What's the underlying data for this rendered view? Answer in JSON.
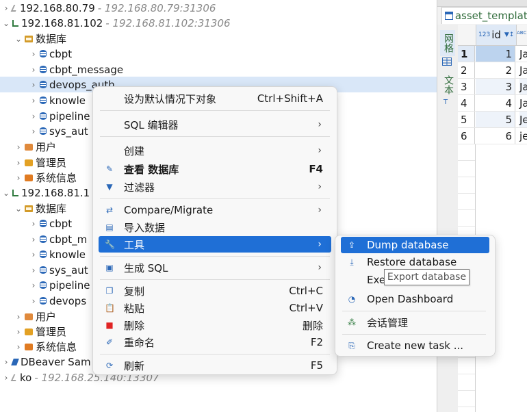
{
  "tree": {
    "conn1": {
      "name": "192.168.80.79",
      "addr": "- 192.168.80.79:31306"
    },
    "conn2": {
      "name": "192.168.81.102",
      "addr": "- 192.168.81.102:31306"
    },
    "conn2_databases": "数据库",
    "conn2_dbs": [
      "cbpt",
      "cbpt_message",
      "devops_auth",
      "knowle",
      "pipeline",
      "sys_aut"
    ],
    "conn2_users": "用户",
    "conn2_admins": "管理员",
    "conn2_sysinfo": "系统信息",
    "conn3": {
      "name": "192.168.81.1"
    },
    "conn3_databases": "数据库",
    "conn3_dbs": [
      "cbpt",
      "cbpt_m",
      "knowle",
      "sys_aut",
      "pipeline",
      "devops"
    ],
    "conn3_users": "用户",
    "conn3_admins": "管理员",
    "conn3_sysinfo": "系统信息",
    "sample": {
      "name": "DBeaver Sam"
    },
    "ko": {
      "name": "ko",
      "addr": "- 192.168.25.140:13307"
    }
  },
  "editor": {
    "tab_title": "asset_template",
    "side_tabs": [
      "网格",
      "文本"
    ],
    "column": "id",
    "rows": [
      {
        "num": "1",
        "id": "1",
        "name": "Ja"
      },
      {
        "num": "2",
        "id": "2",
        "name": "Ja"
      },
      {
        "num": "3",
        "id": "3",
        "name": "Ja"
      },
      {
        "num": "4",
        "id": "4",
        "name": "Ja"
      },
      {
        "num": "5",
        "id": "5",
        "name": "Je"
      },
      {
        "num": "6",
        "id": "6",
        "name": "je"
      }
    ]
  },
  "context_menu": {
    "items": [
      {
        "label": "设为默认情况下对象",
        "shortcut": "Ctrl+Shift+A"
      },
      {
        "label": "SQL 编辑器",
        "submenu": "›"
      },
      {
        "label": "创建",
        "submenu": "›"
      },
      {
        "label": "查看 数据库",
        "shortcut": "F4"
      },
      {
        "label": "过滤器",
        "submenu": "›"
      },
      {
        "label": "Compare/Migrate",
        "submenu": "›"
      },
      {
        "label": "导入数据"
      },
      {
        "label": "工具",
        "submenu": "›"
      },
      {
        "label": "生成 SQL",
        "submenu": "›"
      },
      {
        "label": "复制",
        "shortcut": "Ctrl+C"
      },
      {
        "label": "粘贴",
        "shortcut": "Ctrl+V"
      },
      {
        "label": "删除",
        "shortcut": "删除"
      },
      {
        "label": "重命名",
        "shortcut": "F2"
      },
      {
        "label": "刷新",
        "shortcut": "F5"
      }
    ]
  },
  "tools_submenu": {
    "items": [
      "Dump database",
      "Restore database",
      "Exe",
      "Open Dashboard",
      "会话管理",
      "Create new task ..."
    ],
    "tooltip": "Export database"
  },
  "colors": {
    "selection": "#1f6fd6",
    "tree_selected": "#d9e7f8",
    "link_green": "#2f6b3a"
  }
}
